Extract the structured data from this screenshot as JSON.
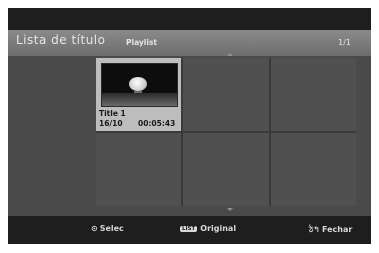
{
  "header": {
    "title": "Lista de título",
    "mode": "Playlist",
    "page_indicator": "1/1"
  },
  "grid": {
    "items": [
      {
        "title": "Title 1",
        "date": "16/10",
        "duration": "00:05:43",
        "selected": true
      }
    ]
  },
  "footer": {
    "select_icon": "⊙",
    "select_label": "Selec",
    "list_button": "LIST",
    "list_label": "Original",
    "return_icon": "ঠ↰",
    "return_label": "Fechar"
  },
  "colors": {
    "header": "#7a7a7a",
    "panel": "#4a4a4a",
    "selected_cell": "#bdbdbd",
    "background": "#1e1e1e"
  }
}
